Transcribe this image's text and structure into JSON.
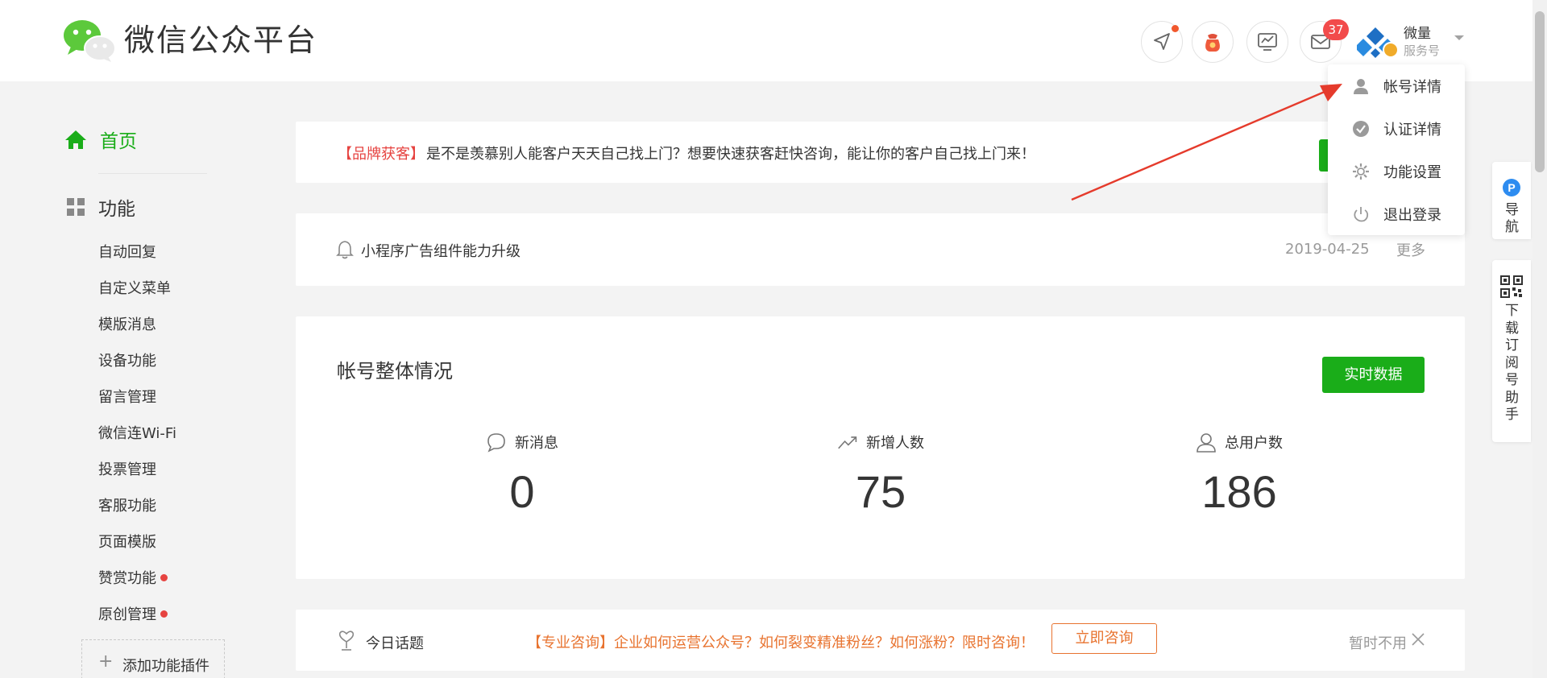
{
  "brand": {
    "title": "微信公众平台"
  },
  "header": {
    "notifications": {
      "message_count": "37"
    },
    "account": {
      "name": "微量",
      "type": "服务号"
    }
  },
  "account_menu": {
    "items": [
      {
        "label": "帐号详情",
        "icon": "user-icon"
      },
      {
        "label": "认证详情",
        "icon": "verified-check-icon"
      },
      {
        "label": "功能设置",
        "icon": "gear-icon"
      },
      {
        "label": "退出登录",
        "icon": "power-icon"
      }
    ]
  },
  "sidebar": {
    "home": {
      "label": "首页"
    },
    "functions": {
      "label": "功能",
      "items": [
        {
          "label": "自动回复"
        },
        {
          "label": "自定义菜单"
        },
        {
          "label": "模版消息"
        },
        {
          "label": "设备功能"
        },
        {
          "label": "留言管理"
        },
        {
          "label": "微信连Wi-Fi"
        },
        {
          "label": "投票管理"
        },
        {
          "label": "客服功能"
        },
        {
          "label": "页面模版"
        },
        {
          "label": "赞赏功能",
          "red_dot": true
        },
        {
          "label": "原创管理",
          "red_dot": true
        }
      ]
    },
    "add_plugin": {
      "plus": "+",
      "label": "添加功能插件"
    }
  },
  "banner": {
    "tag": "【品牌获客】",
    "message": "是不是羡慕别人能客户天天自己找上门？想要快速获客赶快咨询，能让你的客户自己找上门来！"
  },
  "notice": {
    "title": "小程序广告组件能力升级",
    "date": "2019-04-25",
    "more": "更多"
  },
  "overview": {
    "title": "帐号整体情况",
    "realtime_button": "实时数据",
    "stats": [
      {
        "label": "新消息",
        "value": "0",
        "icon": "chat-bubble-icon"
      },
      {
        "label": "新增人数",
        "value": "75",
        "icon": "trend-up-icon"
      },
      {
        "label": "总用户数",
        "value": "186",
        "icon": "user-outline-icon"
      }
    ]
  },
  "topic": {
    "label": "今日话题",
    "promo": "【专业咨询】企业如何运营公众号？如何裂变精准粉丝？如何涨粉？限时咨询！",
    "consult_button": "立即咨询",
    "dismiss": "暂时不用"
  },
  "floating": {
    "nav": {
      "badge": "P",
      "label": "导航"
    },
    "qr": {
      "label": "下载订阅号助手"
    }
  },
  "colors": {
    "brand_green": "#1aad19",
    "alert_red": "#e64340",
    "promo_orange": "#e8732f",
    "badge_red": "#f24b4b",
    "annotation_red": "#e53b2c"
  }
}
